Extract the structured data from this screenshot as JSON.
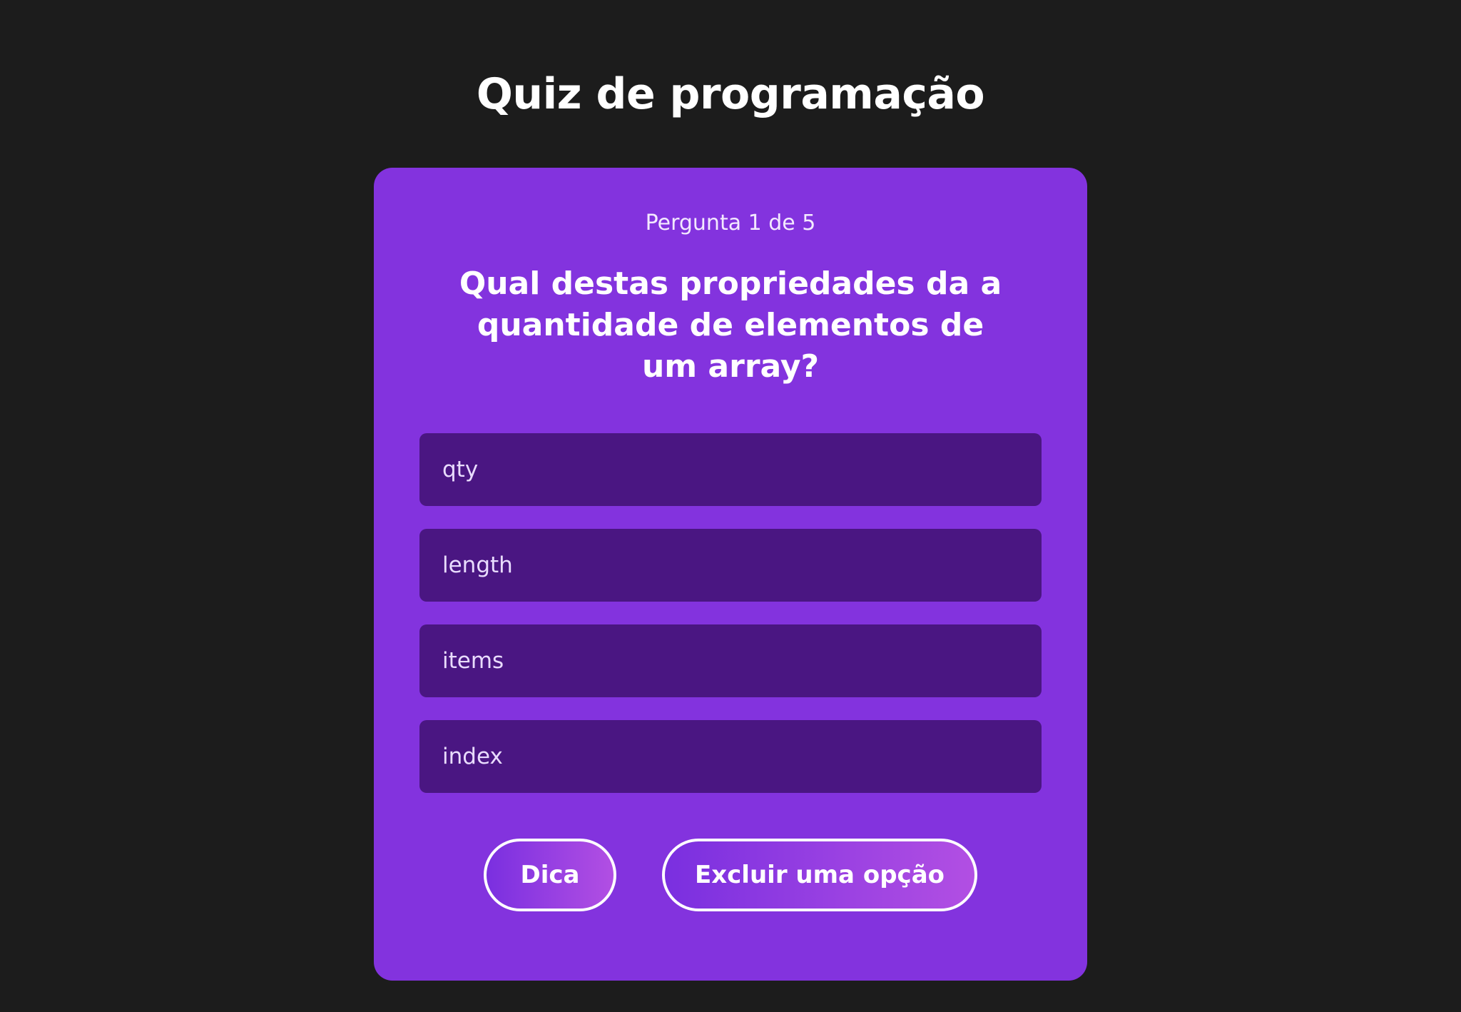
{
  "header": {
    "title": "Quiz de programação"
  },
  "quiz": {
    "counter": "Pergunta 1 de 5",
    "question": "Qual destas propriedades da a quantidade de elementos de um array?",
    "options": [
      {
        "label": "qty"
      },
      {
        "label": "length"
      },
      {
        "label": "items"
      },
      {
        "label": "index"
      }
    ],
    "actions": {
      "hint_label": "Dica",
      "exclude_label": "Excluir uma opção"
    }
  },
  "colors": {
    "background": "#1c1c1c",
    "card": "#8333de",
    "option": "#4a1682",
    "button_gradient_start": "#7a2fe0",
    "button_gradient_end": "#b24fe3"
  }
}
